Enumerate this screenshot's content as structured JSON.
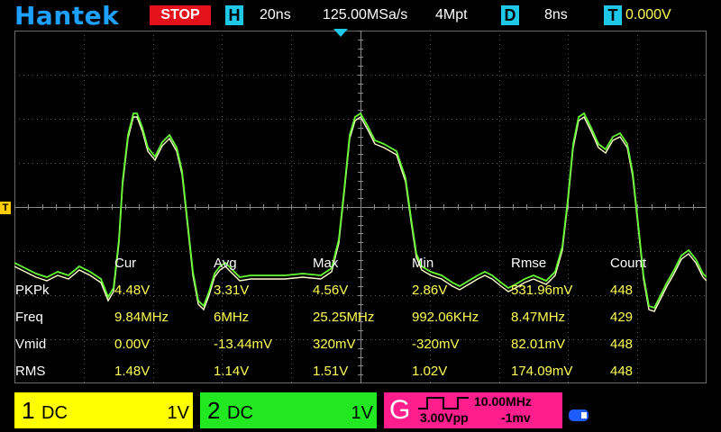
{
  "topbar": {
    "logo": "Hantek",
    "run_state": "STOP",
    "horiz_letter": "H",
    "timebase": "20ns",
    "sample_rate": "125.00MSa/s",
    "memory_depth": "4Mpt",
    "delay_letter": "D",
    "delay": "8ns",
    "trigger_letter": "T",
    "trigger_level": "0.000V",
    "colors": {
      "logo": "#1ea0ff",
      "stop": "#e5121c",
      "letterbox": "#1ec8e8"
    }
  },
  "markers": {
    "trigger_side": "T"
  },
  "measurements": {
    "columns": [
      "Cur",
      "Avg",
      "Max",
      "Min",
      "Rmse",
      "Count"
    ],
    "rows": [
      {
        "name": "PKPk",
        "values": [
          "4.48V",
          "3.31V",
          "4.56V",
          "2.86V",
          "531.96mV",
          "448"
        ]
      },
      {
        "name": "Freq",
        "values": [
          "9.84MHz",
          "6MHz",
          "25.25MHz",
          "992.06KHz",
          "8.47MHz",
          "429"
        ]
      },
      {
        "name": "Vmid",
        "values": [
          "0.00V",
          "-13.44mV",
          "320mV",
          "-320mV",
          "82.01mV",
          "448"
        ]
      },
      {
        "name": "RMS",
        "values": [
          "1.48V",
          "1.14V",
          "1.51V",
          "1.02V",
          "174.09mV",
          "448"
        ]
      }
    ]
  },
  "channels": {
    "ch1": {
      "number": "1",
      "coupling": "DC",
      "scale": "1V",
      "color": "#ffff00"
    },
    "ch2": {
      "number": "2",
      "coupling": "DC",
      "scale": "1V",
      "color": "#22e822"
    },
    "gen": {
      "label": "G",
      "frequency": "10.00MHz",
      "amplitude": "3.00Vpp",
      "offset": "-1mv",
      "color": "#ff1e8c"
    }
  },
  "icons": {
    "usb": "usb-icon",
    "trigger_position": "trigger-position-icon",
    "trigger_level": "trigger-level-icon"
  }
}
